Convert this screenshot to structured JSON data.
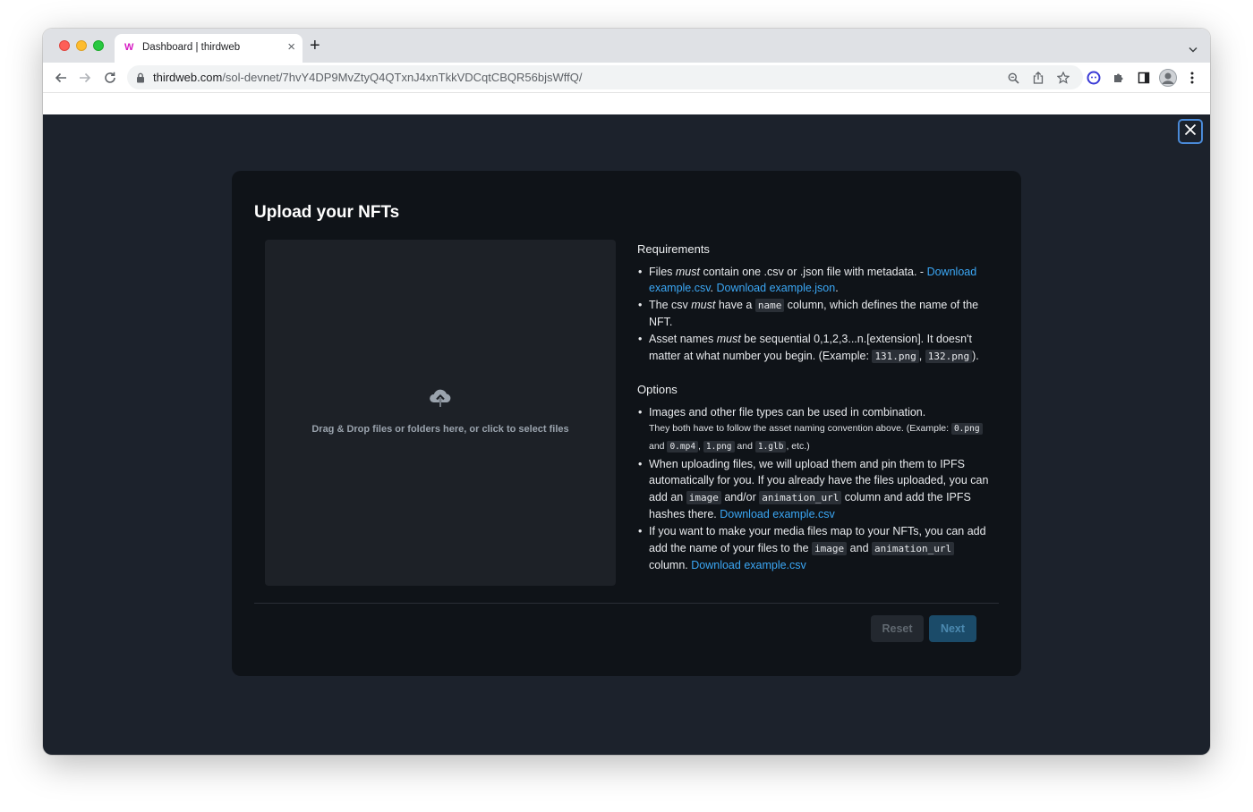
{
  "browser": {
    "tab_title": "Dashboard | thirdweb",
    "tab_favicon": "W",
    "tab_close": "×",
    "new_tab": "+",
    "url_host": "thirdweb.com",
    "url_path": "/sol-devnet/7hvY4DP9MvZtyQ4QTxnJ4xnTkkVDCqtCBQR56bjsWffQ/",
    "icons": {
      "back": "arrow-left-icon",
      "forward": "arrow-right-icon",
      "reload": "reload-icon",
      "lock": "lock-icon",
      "zoom": "zoom-icon",
      "share": "share-icon",
      "bookmark": "star-icon",
      "extension_badge": "extension-icon",
      "extensions": "puzzle-icon",
      "side_panel": "side-panel-icon",
      "profile": "avatar",
      "menu": "kebab-menu-icon"
    },
    "colors": {
      "tabstrip": "#dfe1e5",
      "favicon": "#d61bc2"
    }
  },
  "modal": {
    "title": "Upload your NFTs",
    "dropzone_text": "Drag & Drop files or folders here, or click to select files",
    "requirements": {
      "title": "Requirements",
      "item1": {
        "a": "Files ",
        "must": "must",
        "b": " contain one .csv or .json file with metadata. - ",
        "link_csv": "Download example.csv",
        "sep": ". ",
        "link_json": "Download example.json",
        "end": "."
      },
      "item2": {
        "a": "The csv ",
        "must": "must",
        "b": " have a ",
        "code": "name",
        "c": " column, which defines the name of the NFT."
      },
      "item3": {
        "a": "Asset names ",
        "must": "must",
        "b": " be sequential 0,1,2,3...n.[extension]. It doesn't matter at what number you begin. (Example: ",
        "code1": "131.png",
        "comma": ", ",
        "code2": "132.png",
        "end": ")."
      }
    },
    "options": {
      "title": "Options",
      "item1": {
        "main": "Images and other file types can be used in combination.",
        "small_a": "They both have to follow the asset naming convention above. (Example: ",
        "code1": "0.png",
        "small_b": " and ",
        "code2": "0.mp4",
        "small_c": ", ",
        "code3": "1.png",
        "small_d": " and ",
        "code4": "1.glb",
        "small_e": ", etc.)"
      },
      "item2": {
        "a": "When uploading files, we will upload them and pin them to IPFS automatically for you. If you already have the files uploaded, you can add an ",
        "code1": "image",
        "b": " and/or ",
        "code2": "animation_url",
        "c": " column and add the IPFS hashes there. ",
        "link": "Download example.csv"
      },
      "item3": {
        "a": "If you want to make your media files map to your NFTs, you can add add the name of your files to the ",
        "code1": "image",
        "b": " and ",
        "code2": "animation_url",
        "c": " column. ",
        "link": "Download example.csv"
      }
    },
    "buttons": {
      "reset": "Reset",
      "next": "Next"
    },
    "icons": {
      "close": "close-icon",
      "upload": "cloud-upload-icon"
    },
    "colors": {
      "overlay": "#1c222c",
      "modal_bg": "#0f1318",
      "dropzone_bg": "#1d2127",
      "link": "#3ba7f5",
      "next_bg": "#1b4b69",
      "close_border": "#4a8ad8"
    }
  }
}
